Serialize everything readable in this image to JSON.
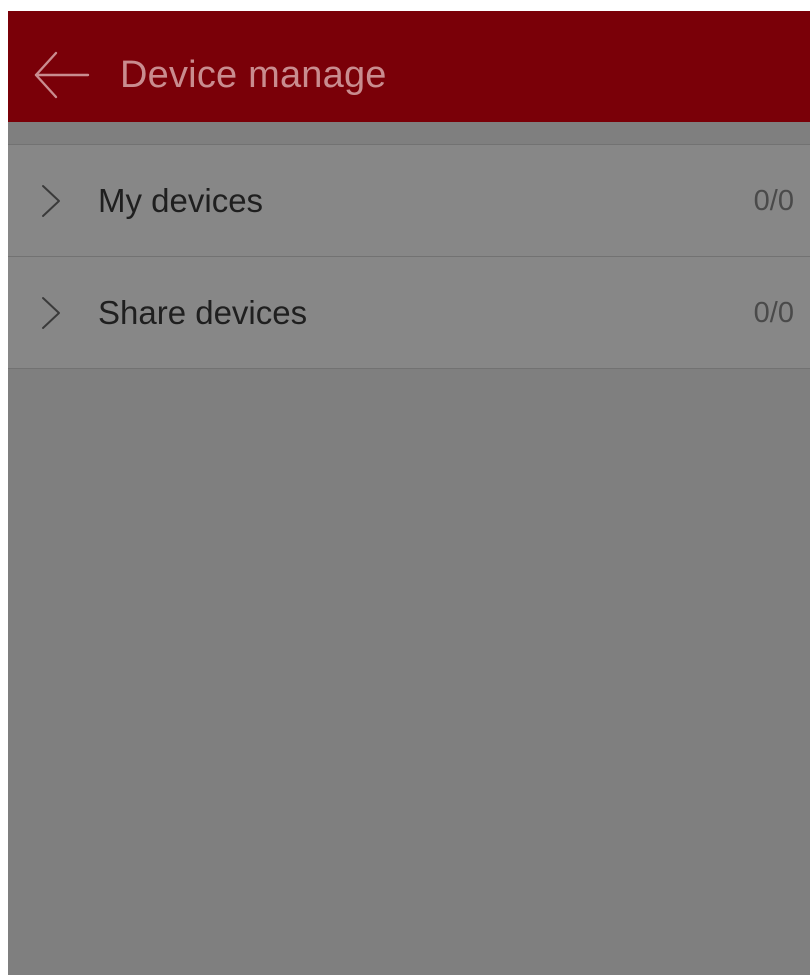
{
  "app_bar": {
    "title": "Device manage",
    "back_icon": "arrow-left-icon",
    "background_color": "#7a0008",
    "title_color": "#c98c8f"
  },
  "device_list": {
    "items": [
      {
        "label": "My devices",
        "count": "0/0",
        "icon": "chevron-right-icon"
      },
      {
        "label": "Share devices",
        "count": "0/0",
        "icon": "chevron-right-icon"
      }
    ]
  },
  "colors": {
    "overlay_gray": "#7f7f7f",
    "row_gray": "#878787",
    "text_dark": "#1f1f1f"
  }
}
